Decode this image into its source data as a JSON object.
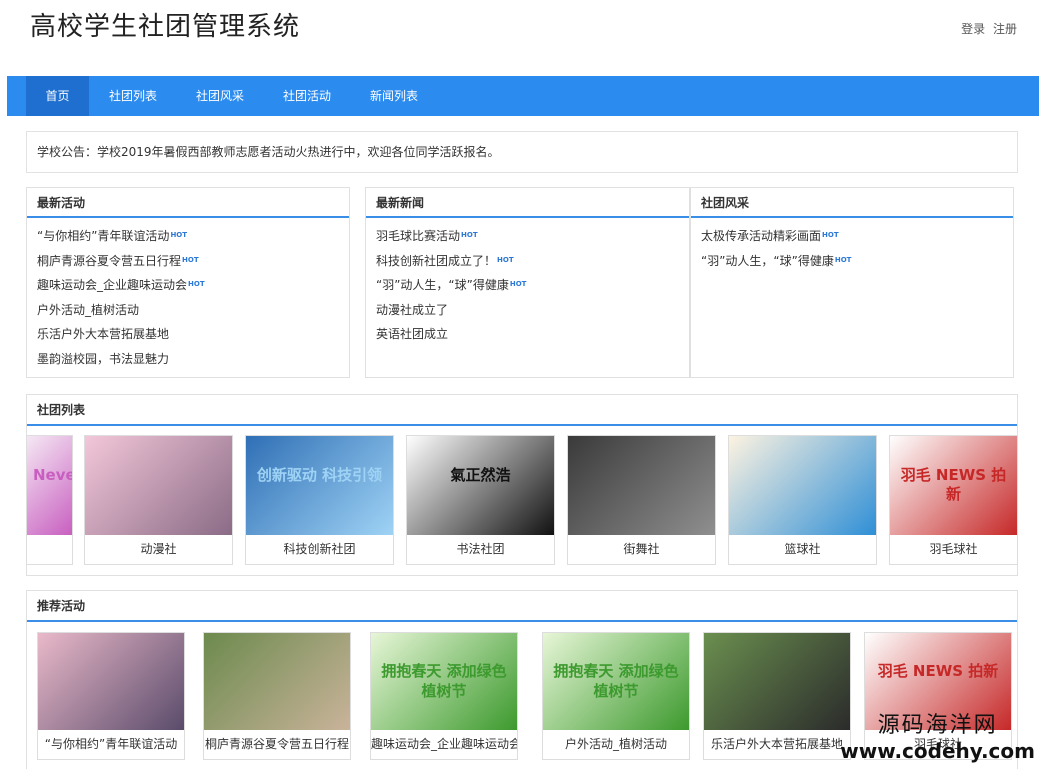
{
  "header": {
    "title": "高校学生社团管理系统",
    "login": "登录",
    "register": "注册"
  },
  "nav": {
    "items": [
      "首页",
      "社团列表",
      "社团风采",
      "社团活动",
      "新闻列表"
    ]
  },
  "notice": "学校公告：学校2019年暑假西部教师志愿者活动火热进行中，欢迎各位同学活跃报名。",
  "panels": {
    "activities": {
      "title": "最新活动",
      "items": [
        {
          "text": "“与你相约”青年联谊活动",
          "hot": "HOT"
        },
        {
          "text": "桐庐青源谷夏令营五日行程",
          "hot": "HOT"
        },
        {
          "text": "趣味运动会_企业趣味运动会",
          "hot": "HOT"
        },
        {
          "text": "户外活动_植树活动",
          "hot": ""
        },
        {
          "text": "乐活户外大本营拓展基地",
          "hot": ""
        },
        {
          "text": "墨韵溢校园，书法显魅力",
          "hot": ""
        }
      ]
    },
    "news": {
      "title": "最新新闻",
      "items": [
        {
          "text": "羽毛球比赛活动",
          "hot": "HOT"
        },
        {
          "text": "科技创新社团成立了！",
          "hot": "HOT"
        },
        {
          "text": "“羽”动人生，“球”得健康",
          "hot": "HOT"
        },
        {
          "text": "动漫社成立了",
          "hot": ""
        },
        {
          "text": "英语社团成立",
          "hot": ""
        }
      ]
    },
    "style": {
      "title": "社团风采",
      "items": [
        {
          "text": "太极传承活动精彩画面",
          "hot": "HOT"
        },
        {
          "text": "“羽”动人生，“球”得健康",
          "hot": "HOT"
        }
      ]
    }
  },
  "clubs": {
    "title": "社团列表",
    "items": [
      {
        "name": "",
        "image_text": "Never",
        "colors": [
          "#f5e8f4",
          "#c85fc0"
        ]
      },
      {
        "name": "动漫社",
        "image_text": "",
        "colors": [
          "#f3c7d9",
          "#8a6b86"
        ]
      },
      {
        "name": "科技创新社团",
        "image_text": "创新驱动 科技引领",
        "colors": [
          "#2f6fb5",
          "#9fd3f5"
        ]
      },
      {
        "name": "书法社团",
        "image_text": "氣正然浩",
        "colors": [
          "#ffffff",
          "#111111"
        ]
      },
      {
        "name": "街舞社",
        "image_text": "",
        "colors": [
          "#3a3a3a",
          "#8f8f8f"
        ]
      },
      {
        "name": "篮球社",
        "image_text": "",
        "colors": [
          "#fdf3e1",
          "#2f8fd6"
        ]
      },
      {
        "name": "羽毛球社",
        "image_text": "羽毛 NEWS 拍新",
        "colors": [
          "#ffffff",
          "#c62828"
        ]
      }
    ]
  },
  "recommend": {
    "title": "推荐活动",
    "items": [
      {
        "name": "“与你相约”青年联谊活动",
        "image_text": "",
        "colors": [
          "#e9b9c9",
          "#5a4b6b"
        ]
      },
      {
        "name": "桐庐青源谷夏令营五日行程",
        "image_text": "",
        "colors": [
          "#6c8a4e",
          "#c9b39a"
        ]
      },
      {
        "name": "趣味运动会_企业趣味运动会",
        "image_text": "拥抱春天 添加绿色 植树节",
        "colors": [
          "#e7f6d7",
          "#3d9a2e"
        ]
      },
      {
        "name": "户外活动_植树活动",
        "image_text": "拥抱春天 添加绿色 植树节",
        "colors": [
          "#e7f6d7",
          "#3d9a2e"
        ]
      },
      {
        "name": "乐活户外大本营拓展基地",
        "image_text": "",
        "colors": [
          "#6a8f4f",
          "#2b2b2b"
        ]
      },
      {
        "name": "羽毛球社",
        "image_text": "羽毛 NEWS 拍新",
        "colors": [
          "#ffffff",
          "#c62828"
        ]
      }
    ]
  },
  "watermark": {
    "line1": "源码海洋网",
    "line2": "www.codehy.com"
  },
  "colors": {
    "nav": "#2b8bef",
    "nav_active": "#1f6fd0",
    "accent": "#3b8ee8",
    "hot": "#2b78d6"
  }
}
